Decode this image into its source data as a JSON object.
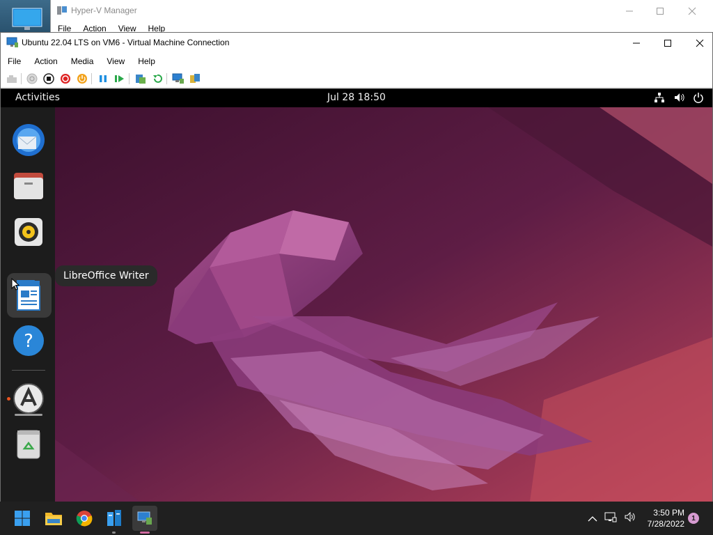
{
  "hyperv_manager": {
    "title": "Hyper-V Manager",
    "menu": [
      "File",
      "Action",
      "View",
      "Help"
    ]
  },
  "vm_window": {
    "title": "Ubuntu 22.04 LTS on VM6 - Virtual Machine Connection",
    "menu": [
      "File",
      "Action",
      "Media",
      "View",
      "Help"
    ],
    "toolbar_icons": [
      "ctrl-alt-del-icon",
      "start-icon",
      "turn-off-icon",
      "shut-down-icon",
      "save-icon",
      "pause-icon",
      "reset-icon",
      "checkpoint-icon",
      "revert-icon",
      "enhanced-session-icon",
      "share-icon"
    ]
  },
  "guest": {
    "activities_label": "Activities",
    "clock": "Jul 28  18:50",
    "tray_icons": [
      "network-icon",
      "volume-icon",
      "power-icon"
    ],
    "dock_items": [
      {
        "name": "thunderbird-icon"
      },
      {
        "name": "files-icon"
      },
      {
        "name": "rhythmbox-icon"
      },
      {
        "name": "libreoffice-writer-icon"
      },
      {
        "name": "help-icon"
      },
      {
        "name": "software-icon"
      },
      {
        "name": "trash-icon"
      }
    ],
    "tooltip": "LibreOffice Writer",
    "colors": {
      "accent": "#e95420",
      "wallpaper_dark": "#2c0d22",
      "wallpaper_mid": "#7a2a55"
    }
  },
  "taskbar": {
    "apps": [
      "start-icon",
      "file-explorer-icon",
      "chrome-icon",
      "server-manager-icon",
      "vm-connection-icon"
    ],
    "time": "3:50 PM",
    "date": "7/28/2022",
    "notification_count": "1",
    "tray_icons": [
      "chevron-up-icon",
      "network-icon",
      "volume-icon"
    ]
  }
}
